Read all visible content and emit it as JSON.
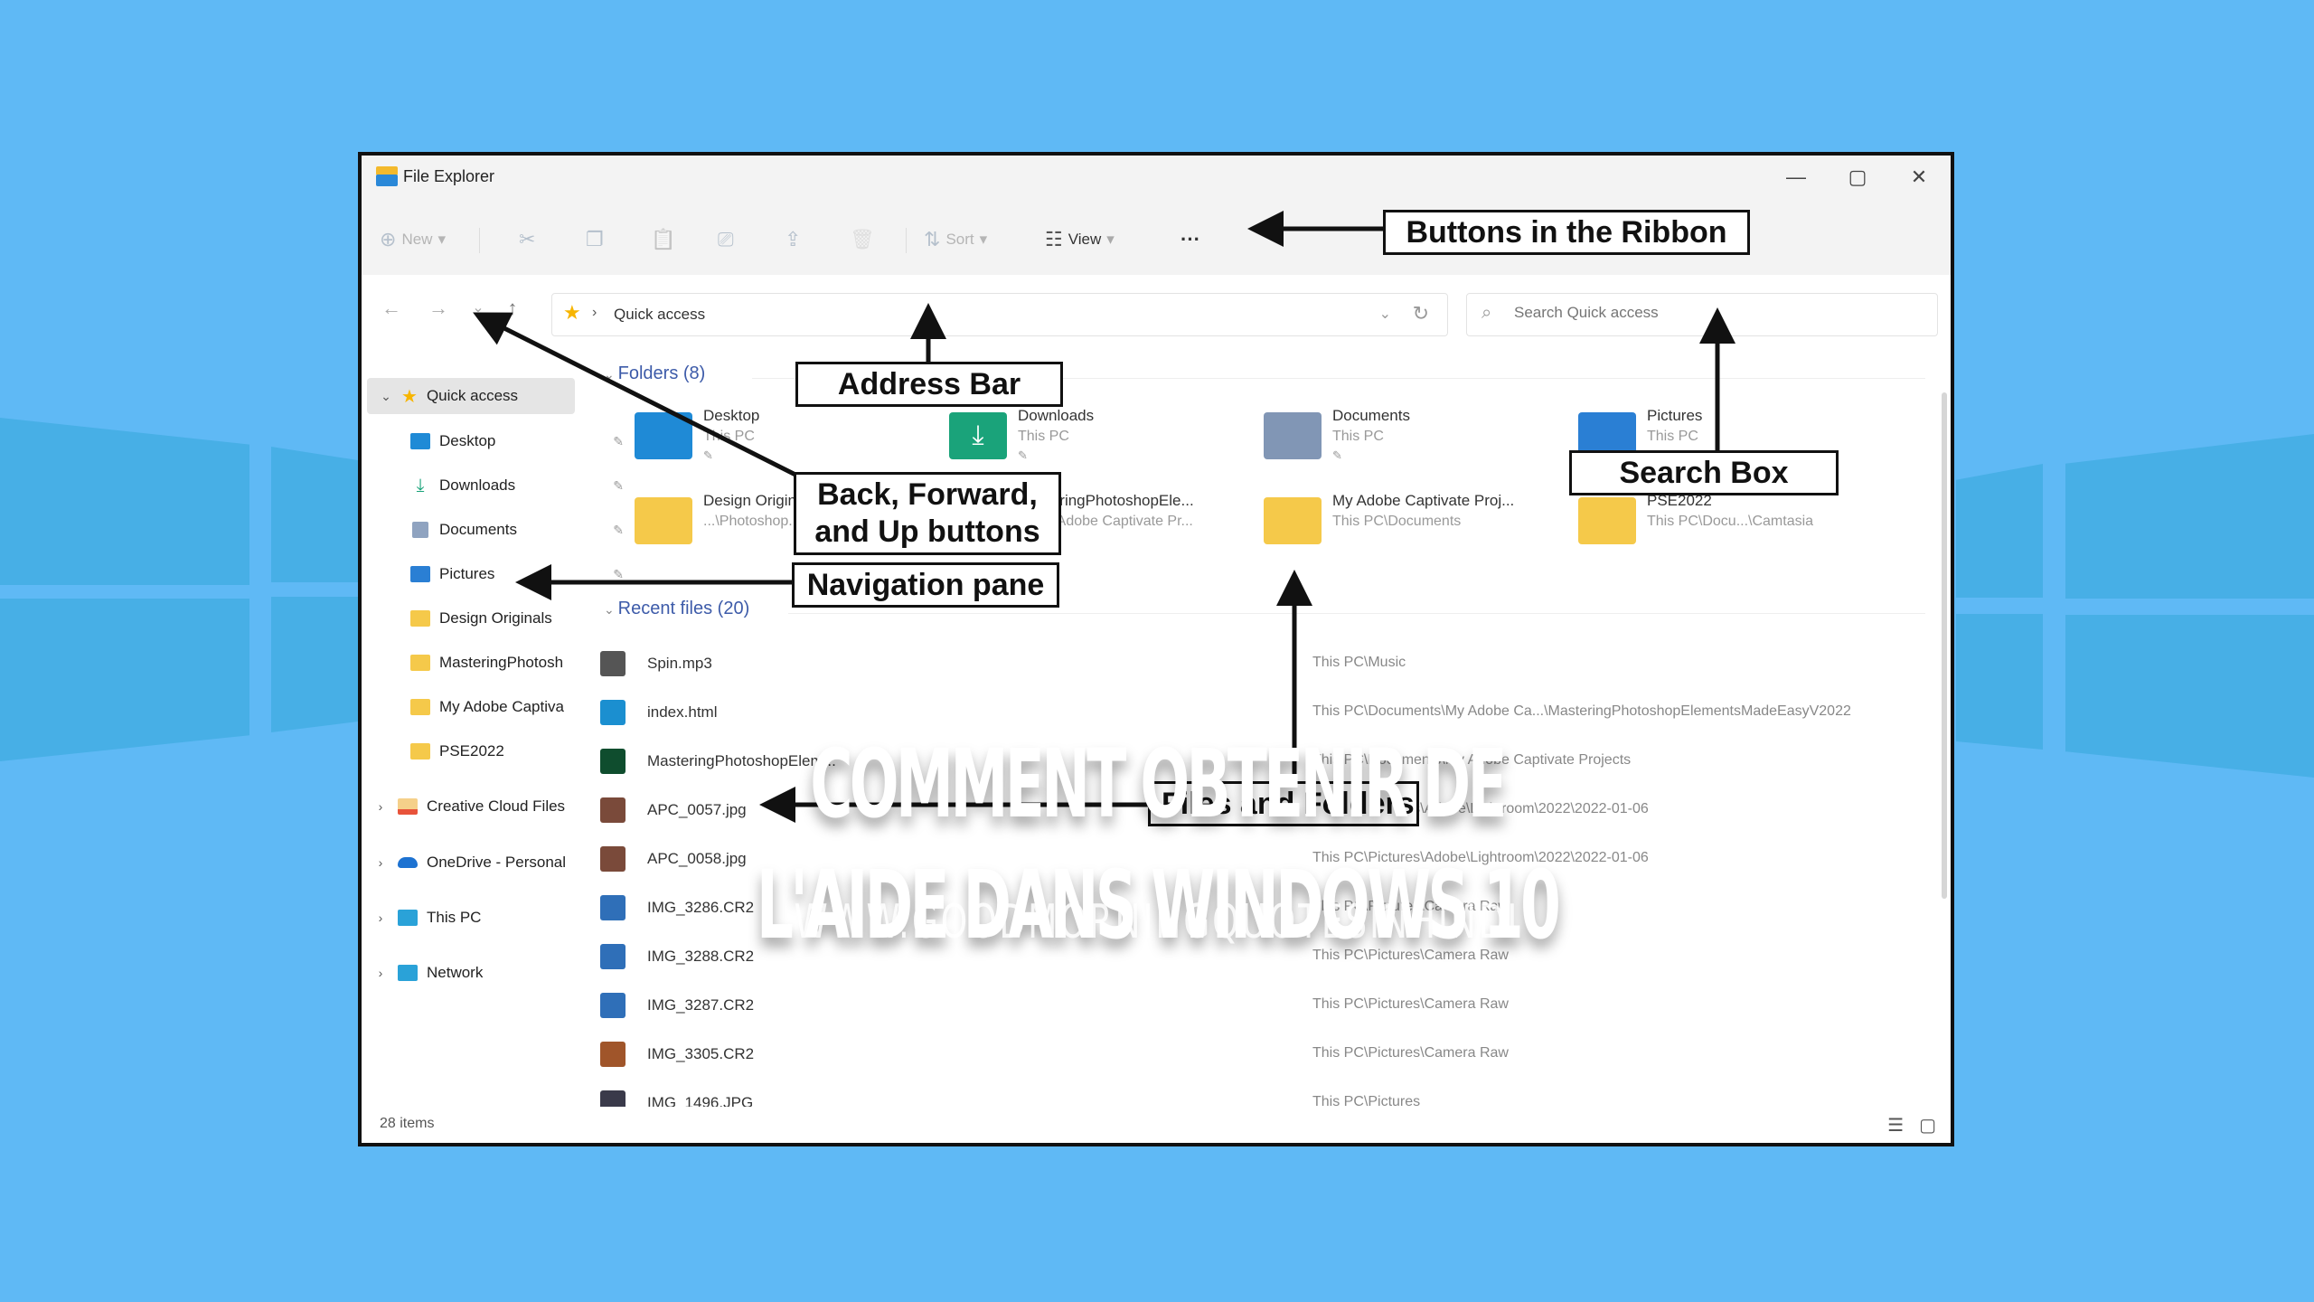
{
  "window": {
    "title": "File Explorer",
    "controls": {
      "minimize": "—",
      "maximize": "▢",
      "close": "✕"
    }
  },
  "ribbon": {
    "buttons": [
      {
        "name": "new",
        "label": "New",
        "icon": "⊕",
        "dropdown": "▾"
      },
      {
        "name": "cut",
        "label": "",
        "icon": "✂"
      },
      {
        "name": "copy",
        "label": "",
        "icon": "❐"
      },
      {
        "name": "paste",
        "label": "",
        "icon": "📋"
      },
      {
        "name": "rename",
        "label": "",
        "icon": "⎚"
      },
      {
        "name": "share",
        "label": "",
        "icon": "⇪"
      },
      {
        "name": "delete",
        "label": "",
        "icon": "🗑"
      },
      {
        "name": "sort",
        "label": "Sort",
        "icon": "⇅",
        "dropdown": "▾"
      },
      {
        "name": "view",
        "label": "View",
        "icon": "☷",
        "dropdown": "▾"
      },
      {
        "name": "more",
        "label": "···",
        "icon": ""
      }
    ]
  },
  "navigation": {
    "back": "←",
    "forward": "→",
    "recent": "⌄",
    "up": "↑"
  },
  "address_bar": {
    "icon": "★",
    "separator": "›",
    "location": "Quick access",
    "dropdown": "⌄",
    "refresh": "↻"
  },
  "search": {
    "icon": "⌕",
    "placeholder": "Search Quick access"
  },
  "nav_pane": {
    "items": [
      {
        "label": "Quick access",
        "chevron": "⌄",
        "selected": true,
        "color": "#f7b500"
      },
      {
        "label": "Desktop",
        "pinned": true,
        "color": "#1f8ad6"
      },
      {
        "label": "Downloads",
        "pinned": true,
        "color": "#1aa37a"
      },
      {
        "label": "Documents",
        "pinned": true,
        "color": "#8fa3c0"
      },
      {
        "label": "Pictures",
        "pinned": true,
        "color": "#2a7fd4"
      },
      {
        "label": "Design Originals",
        "color": "#f5c94a"
      },
      {
        "label": "MasteringPhotosh",
        "color": "#f5c94a"
      },
      {
        "label": "My Adobe Captiva",
        "color": "#f5c94a"
      },
      {
        "label": "PSE2022",
        "color": "#f5c94a"
      },
      {
        "label": "Creative Cloud Files",
        "chevron": "›",
        "color": "#e8533a"
      },
      {
        "label": "OneDrive - Personal",
        "chevron": "›",
        "color": "#1d72d1"
      },
      {
        "label": "This PC",
        "chevron": "›",
        "color": "#2aa2d8"
      },
      {
        "label": "Network",
        "chevron": "›",
        "color": "#2aa2d8"
      }
    ],
    "pin_icon": "📌"
  },
  "folders": {
    "header": "Folders (8)",
    "items": [
      {
        "name": "Desktop",
        "location": "This PC",
        "pinned": true,
        "color": "#1f8ad6"
      },
      {
        "name": "Downloads",
        "location": "This PC",
        "pinned": true,
        "color": "#1aa37a"
      },
      {
        "name": "Documents",
        "location": "This PC",
        "pinned": true,
        "color": "#8196b5"
      },
      {
        "name": "Pictures",
        "location": "This PC",
        "pinned": true,
        "color": "#2a7fd4"
      },
      {
        "name": "Design Originals",
        "location": "...\\Photoshop...",
        "color": "#f5c94a"
      },
      {
        "name": "MasteringPhotoshopEle...",
        "location": "...\\My Adobe Captivate Pr...",
        "color": "#f5c94a"
      },
      {
        "name": "My Adobe Captivate Proj...",
        "location": "This PC\\Documents",
        "color": "#f5c94a"
      },
      {
        "name": "PSE2022",
        "location": "This PC\\Docu...\\Camtasia",
        "color": "#f5c94a"
      }
    ]
  },
  "recent_files": {
    "header": "Recent files (20)",
    "items": [
      {
        "name": "Spin.mp3",
        "path": "This PC\\Music",
        "color": "#555555"
      },
      {
        "name": "index.html",
        "path": "This PC\\Documents\\My Adobe Ca...\\MasteringPhotoshopElementsMadeEasyV2022",
        "color": "#1b8fd0"
      },
      {
        "name": "MasteringPhotoshopElem...",
        "path": "This PC\\Documents\\My Adobe Captivate Projects",
        "color": "#0f4d2e"
      },
      {
        "name": "APC_0057.jpg",
        "path": "This PC\\Pictures\\Adobe\\Lightroom\\2022\\2022-01-06",
        "color": "#7a4a3a"
      },
      {
        "name": "APC_0058.jpg",
        "path": "This PC\\Pictures\\Adobe\\Lightroom\\2022\\2022-01-06",
        "color": "#7a4a3a"
      },
      {
        "name": "IMG_3286.CR2",
        "path": "This PC\\Pictures\\Camera Raw",
        "color": "#2f6fb8"
      },
      {
        "name": "IMG_3288.CR2",
        "path": "This PC\\Pictures\\Camera Raw",
        "color": "#2f6fb8"
      },
      {
        "name": "IMG_3287.CR2",
        "path": "This PC\\Pictures\\Camera Raw",
        "color": "#2f6fb8"
      },
      {
        "name": "IMG_3305.CR2",
        "path": "This PC\\Pictures\\Camera Raw",
        "color": "#a0552a"
      },
      {
        "name": "IMG_1496.JPG",
        "path": "This PC\\Pictures",
        "color": "#3a3a4a"
      }
    ]
  },
  "status_bar": {
    "item_count": "28 items",
    "details_view_icon": "☰",
    "tiles_view_icon": "▢"
  },
  "annotations": {
    "ribbon": "Buttons  in the Ribbon",
    "address_bar": "Address  Bar",
    "back_forward_up_line1": "Back, Forward,",
    "back_forward_up_line2": "and Up buttons",
    "search_box": "Search Box",
    "navigation_pane": "Navigation pane",
    "files_folders": "Files and Folders"
  },
  "overlay": {
    "title_line1": "COMMENT OBTENIR DE",
    "title_line2": "L'AIDE DANS WINDOWS 10",
    "watermark": "WWW.GOODMORNINGQUOTESINHINDI"
  },
  "colors": {
    "background": "#5fb9f5",
    "background_panes": "#47afe6",
    "accent_blue": "#3d5ba9",
    "window_chrome": "#f3f3f3"
  }
}
